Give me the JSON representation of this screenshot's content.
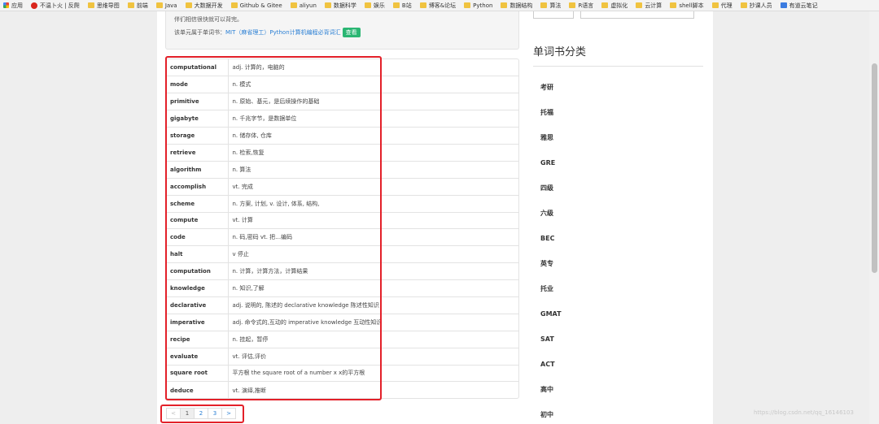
{
  "bookmarks": [
    {
      "label": "应用",
      "icon": "apps-icon",
      "kind": "apps"
    },
    {
      "label": "不温卜火 | 反爬",
      "icon": "csdn-icon",
      "kind": "red"
    },
    {
      "label": "思维导图",
      "icon": "folder-icon",
      "kind": "folder"
    },
    {
      "label": "前端",
      "icon": "folder-icon",
      "kind": "folder"
    },
    {
      "label": "Java",
      "icon": "folder-icon",
      "kind": "folder"
    },
    {
      "label": "大数据开发",
      "icon": "folder-icon",
      "kind": "folder"
    },
    {
      "label": "Github & Gitee",
      "icon": "folder-icon",
      "kind": "folder"
    },
    {
      "label": "aliyun",
      "icon": "folder-icon",
      "kind": "folder"
    },
    {
      "label": "数据科学",
      "icon": "folder-icon",
      "kind": "folder"
    },
    {
      "label": "娱乐",
      "icon": "folder-icon",
      "kind": "folder"
    },
    {
      "label": "B站",
      "icon": "folder-icon",
      "kind": "folder"
    },
    {
      "label": "博客&论坛",
      "icon": "folder-icon",
      "kind": "folder"
    },
    {
      "label": "Python",
      "icon": "folder-icon",
      "kind": "folder"
    },
    {
      "label": "数据结构",
      "icon": "folder-icon",
      "kind": "folder"
    },
    {
      "label": "算法",
      "icon": "folder-icon",
      "kind": "folder"
    },
    {
      "label": "R语言",
      "icon": "folder-icon",
      "kind": "folder"
    },
    {
      "label": "虚拟化",
      "icon": "folder-icon",
      "kind": "folder"
    },
    {
      "label": "云计算",
      "icon": "folder-icon",
      "kind": "folder"
    },
    {
      "label": "shell脚本",
      "icon": "folder-icon",
      "kind": "folder"
    },
    {
      "label": "代理",
      "icon": "folder-icon",
      "kind": "folder"
    },
    {
      "label": "抄课人员",
      "icon": "folder-icon",
      "kind": "folder"
    },
    {
      "label": "有道云笔记",
      "icon": "youdao-icon",
      "kind": "blue"
    }
  ],
  "info": {
    "line1": "伴们相信很快就可以背完。",
    "belongs_prefix": "该单元属于单词书：",
    "book_link": "MIT（麻省理工）Python计算机编程必背词汇",
    "view_button": "查看"
  },
  "words": [
    {
      "word": "computational",
      "meaning": "adj. 计算的，电脑的"
    },
    {
      "word": "mode",
      "meaning": "n. 模式"
    },
    {
      "word": "primitive",
      "meaning": "n. 原始、基元，是后续操作的基础"
    },
    {
      "word": "gigabyte",
      "meaning": "n. 千兆字节，是数据单位"
    },
    {
      "word": "storage",
      "meaning": "n. 储存体, 仓库"
    },
    {
      "word": "retrieve",
      "meaning": "n. 检索,恢复"
    },
    {
      "word": "algorithm",
      "meaning": "n. 算法"
    },
    {
      "word": "accomplish",
      "meaning": "vt. 完成"
    },
    {
      "word": "scheme",
      "meaning": "n. 方案, 计划, v. 设计, 体系, 结构,"
    },
    {
      "word": "compute",
      "meaning": "vt. 计算"
    },
    {
      "word": "code",
      "meaning": "n. 码,密码 vt. 把…编码"
    },
    {
      "word": "halt",
      "meaning": "v 停止"
    },
    {
      "word": "computation",
      "meaning": "n. 计算，计算方法，计算结果"
    },
    {
      "word": "knowledge",
      "meaning": "n. 知识,了解"
    },
    {
      "word": "declarative",
      "meaning": "adj. 说明的, 陈述的 declarative knowledge 陈述性知识"
    },
    {
      "word": "imperative",
      "meaning": "adj. 命令式的,互动的 imperative knowledge 互动性知识"
    },
    {
      "word": "recipe",
      "meaning": "n. 挂起，暂停"
    },
    {
      "word": "evaluate",
      "meaning": "vt. 评估,评价"
    },
    {
      "word": "square root",
      "meaning": "平方根 the square root of a number x x的平方根"
    },
    {
      "word": "deduce",
      "meaning": "vt. 演绎,推断"
    }
  ],
  "pagination": {
    "prev": "<",
    "pages": [
      "1",
      "2",
      "3"
    ],
    "next": ">",
    "current": "1"
  },
  "sidebar": {
    "title": "单词书分类",
    "categories": [
      "考研",
      "托福",
      "雅思",
      "GRE",
      "四级",
      "六级",
      "BEC",
      "英专",
      "托业",
      "GMAT",
      "SAT",
      "ACT",
      "高中",
      "初中"
    ]
  },
  "watermark": "https://blog.csdn.net/qq_16146103"
}
